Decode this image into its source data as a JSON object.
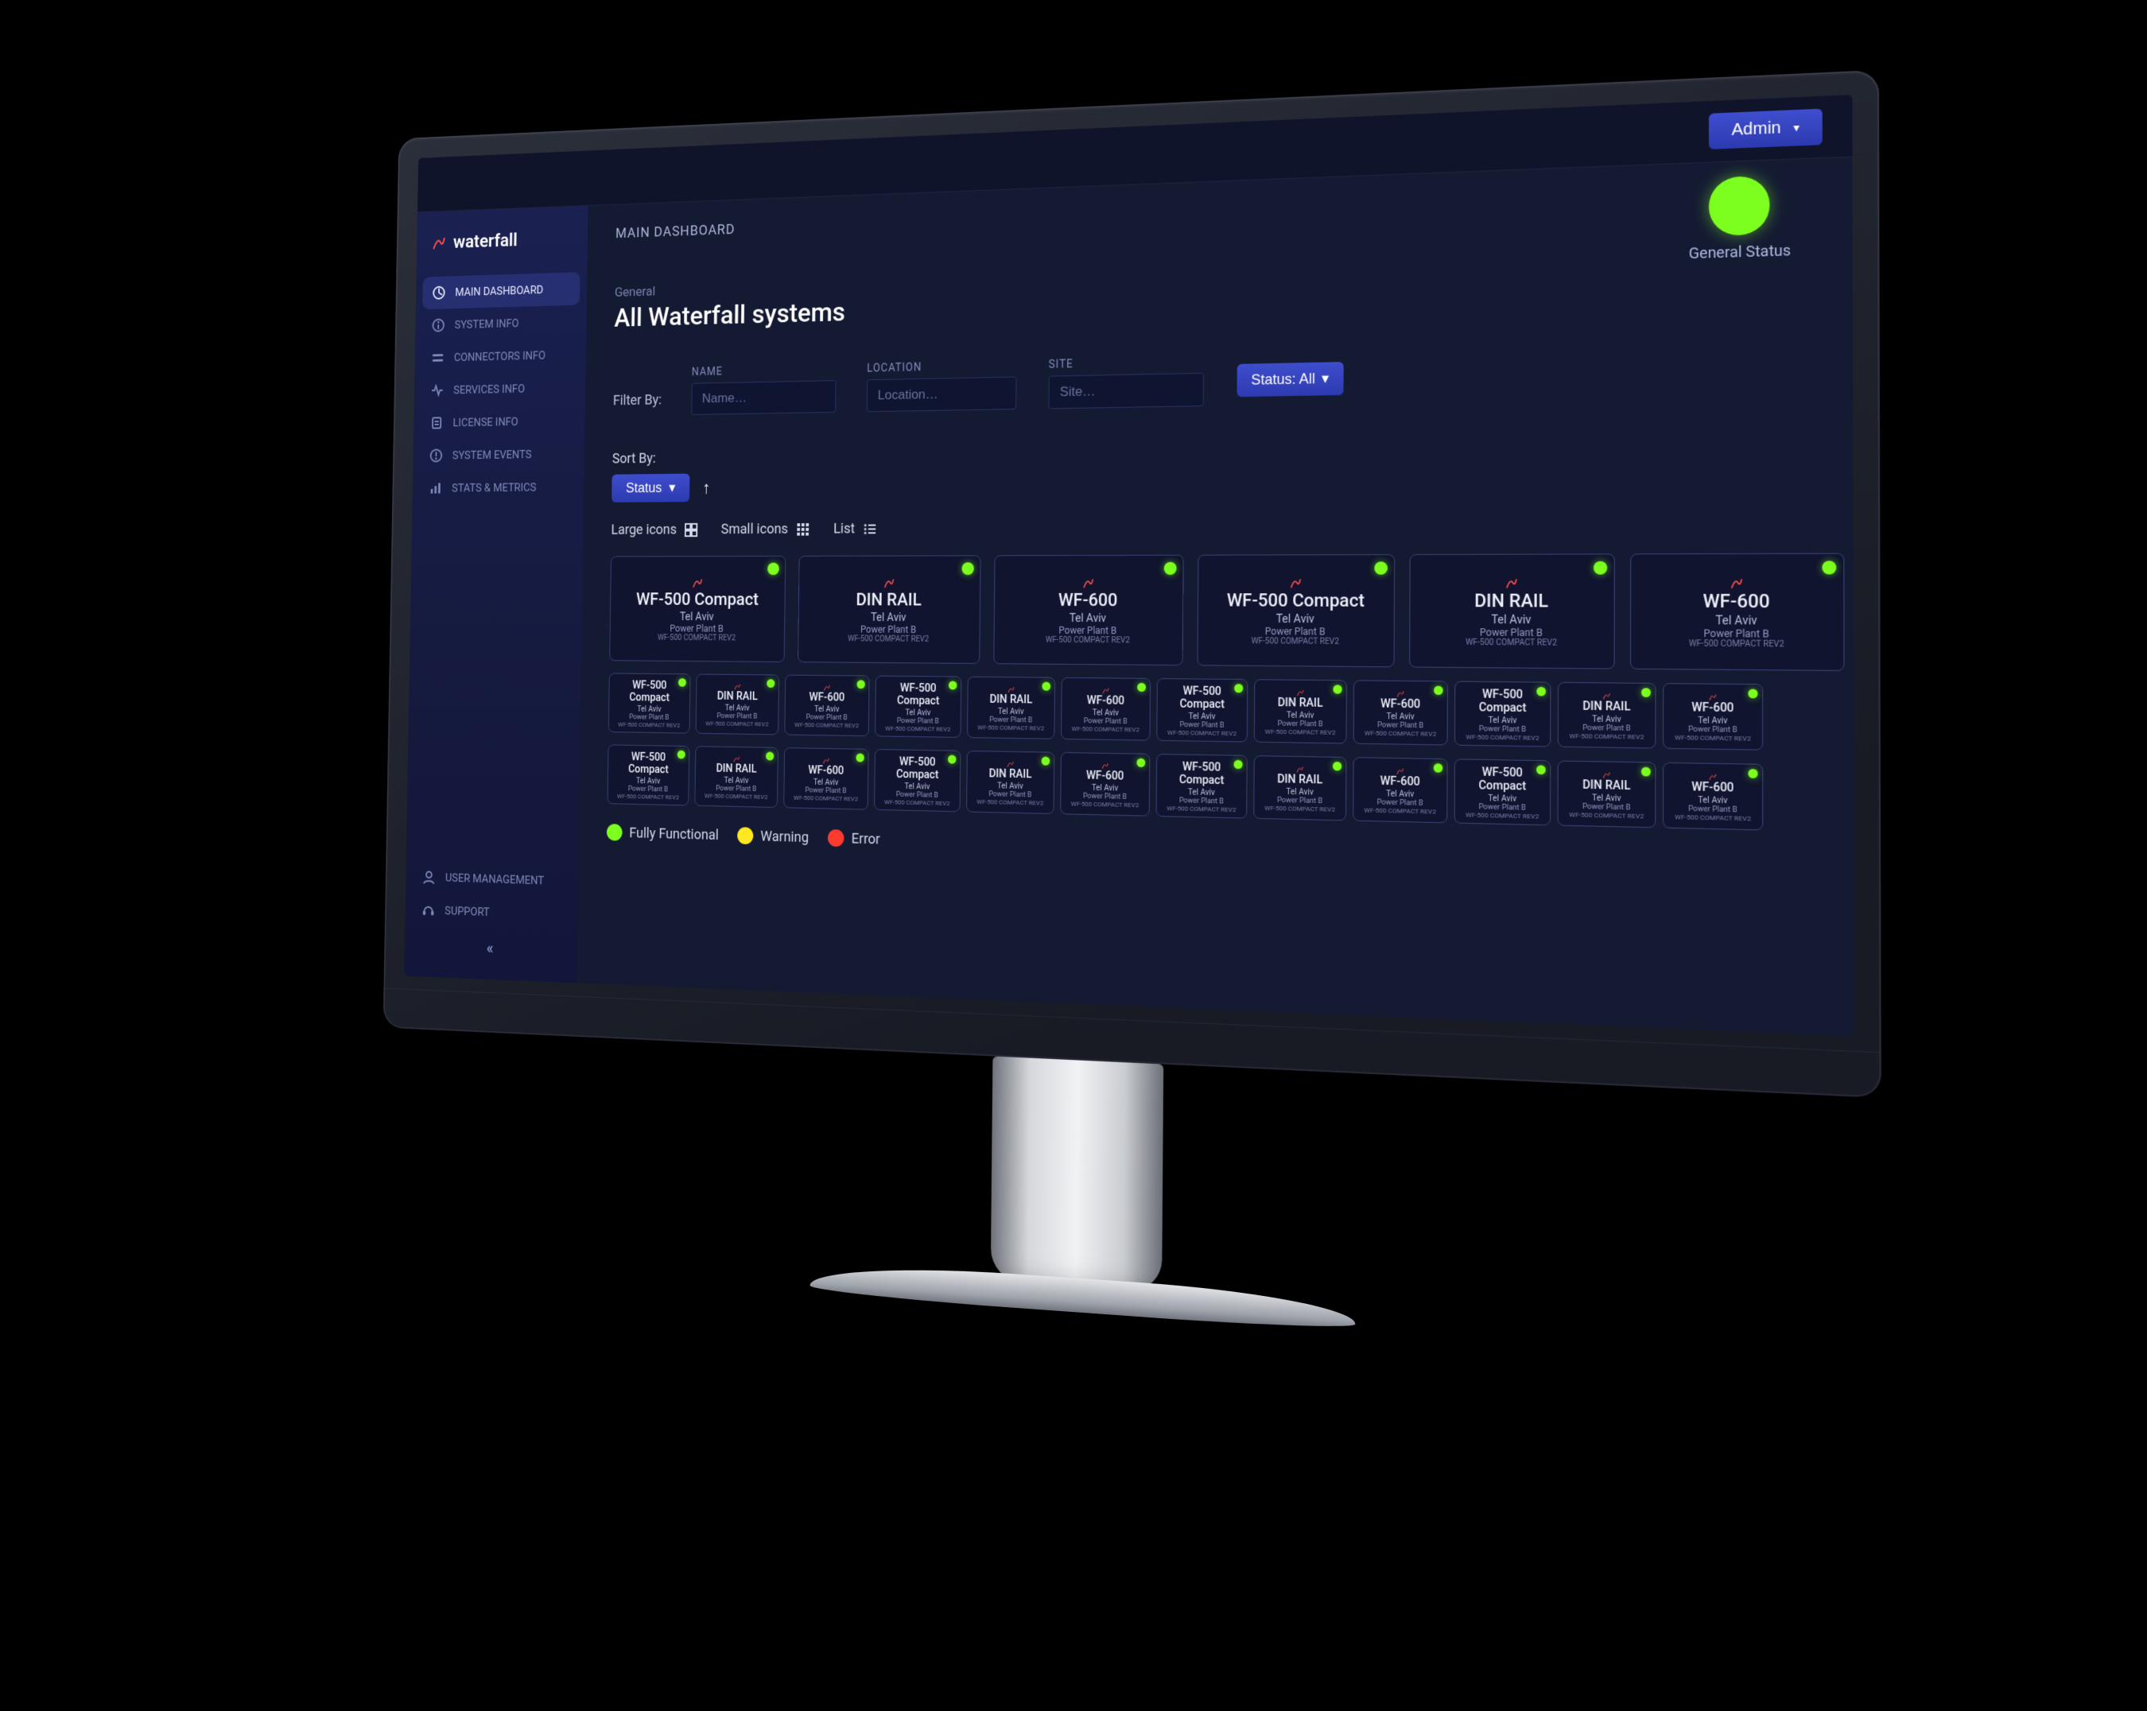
{
  "topbar": {
    "admin_label": "Admin"
  },
  "brand": {
    "name": "waterfall"
  },
  "sidebar": {
    "items": [
      {
        "label": "MAIN DASHBOARD",
        "icon": "dashboard",
        "active": true
      },
      {
        "label": "SYSTEM INFO",
        "icon": "info"
      },
      {
        "label": "CONNECTORS INFO",
        "icon": "connectors"
      },
      {
        "label": "SERVICES INFO",
        "icon": "services"
      },
      {
        "label": "LICENSE INFO",
        "icon": "license"
      },
      {
        "label": "SYSTEM EVENTS",
        "icon": "events"
      },
      {
        "label": "STATS & METRICS",
        "icon": "stats"
      }
    ],
    "bottom": [
      {
        "label": "USER MANAGEMENT",
        "icon": "user"
      },
      {
        "label": "SUPPORT",
        "icon": "support"
      }
    ]
  },
  "page": {
    "title": "MAIN DASHBOARD",
    "crumb": "General",
    "subtitle": "All Waterfall systems",
    "general_status_label": "General Status"
  },
  "filters": {
    "label": "Filter By:",
    "name": {
      "label": "NAME",
      "placeholder": "Name…"
    },
    "location": {
      "label": "LOCATION",
      "placeholder": "Location…"
    },
    "site": {
      "label": "SITE",
      "placeholder": "Site…"
    },
    "status_button": "Status: All"
  },
  "sort": {
    "label": "Sort By:",
    "button": "Status"
  },
  "view": {
    "large": "Large icons",
    "small": "Small icons",
    "list": "List"
  },
  "legend": {
    "ok": "Fully Functional",
    "warn": "Warning",
    "err": "Error"
  },
  "device_template": {
    "loc": "Tel Aviv",
    "sub": "Power Plant B",
    "rev": "WF-500 COMPACT REV2"
  },
  "device_names": {
    "wf500c": "WF-500 Compact",
    "dinrail": "DIN RAIL",
    "wf600": "WF-600"
  },
  "rows": {
    "row1": [
      "wf500c",
      "dinrail",
      "wf600",
      "wf500c",
      "dinrail",
      "wf600"
    ],
    "row2": [
      "wf500c",
      "dinrail",
      "wf600",
      "wf500c",
      "dinrail",
      "wf600",
      "wf500c",
      "dinrail",
      "wf600",
      "wf500c",
      "dinrail",
      "wf600"
    ],
    "row3": [
      "wf500c",
      "dinrail",
      "wf600",
      "wf500c",
      "dinrail",
      "wf600",
      "wf500c",
      "dinrail",
      "wf600",
      "wf500c",
      "dinrail",
      "wf600"
    ]
  }
}
